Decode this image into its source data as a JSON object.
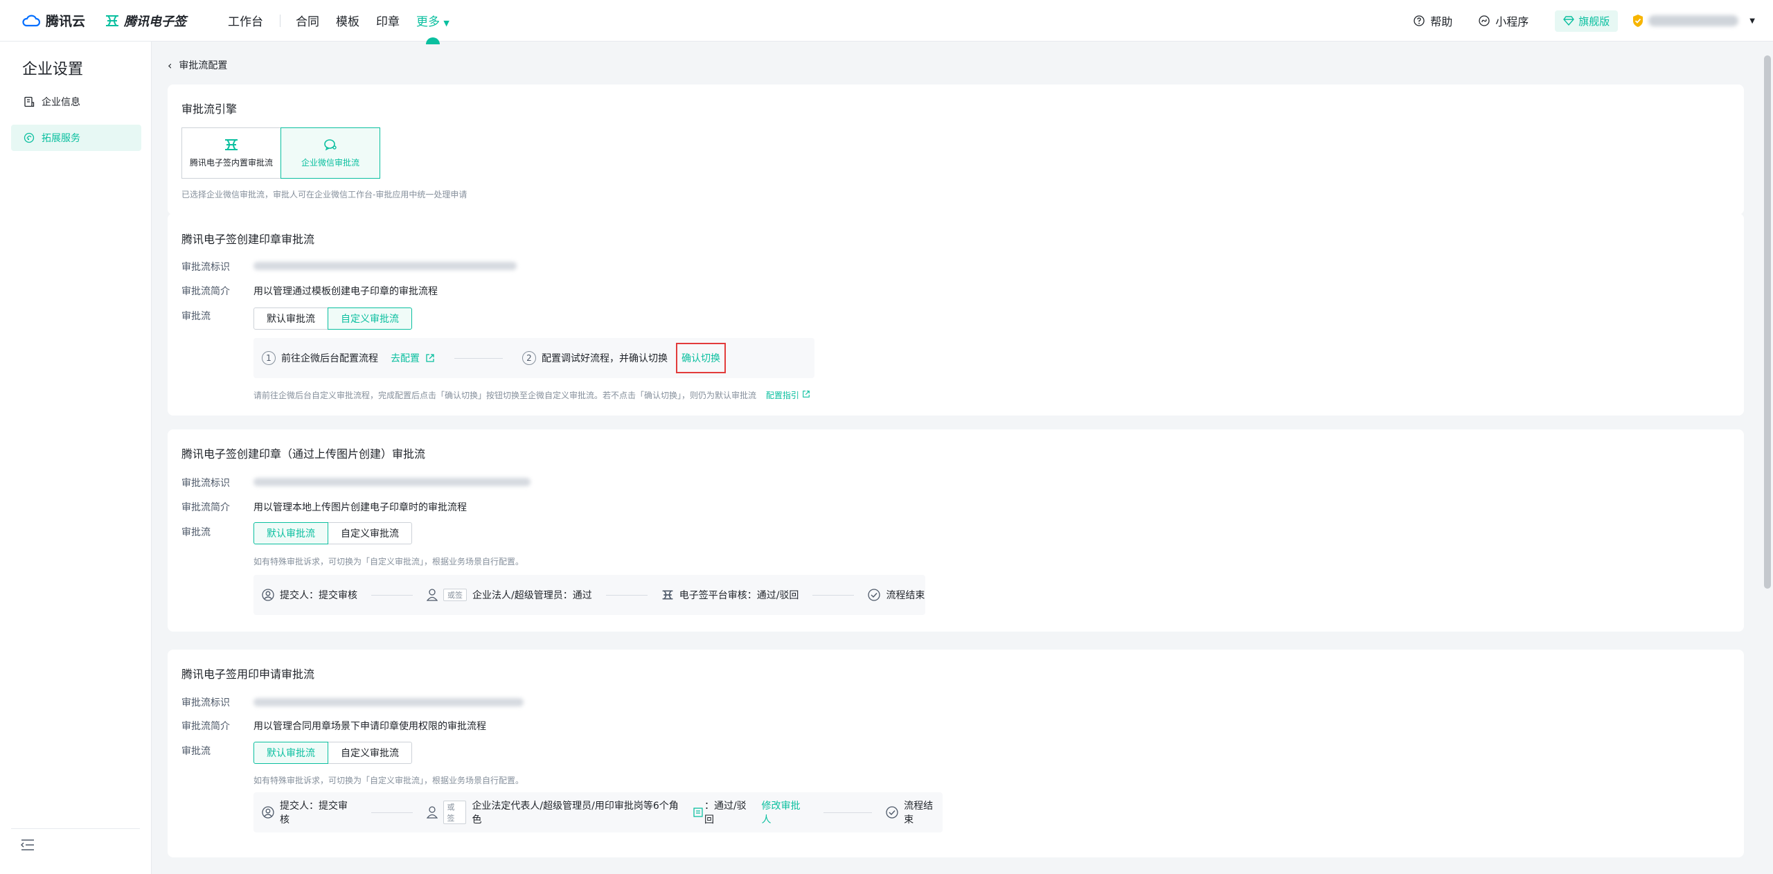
{
  "header": {
    "brand1": "腾讯云",
    "brand2": "腾讯电子签",
    "nav": [
      "工作台",
      "合同",
      "模板",
      "印章",
      "更多"
    ],
    "help": "帮助",
    "miniprogram": "小程序",
    "edition": "旗舰版"
  },
  "sidebar": {
    "title": "企业设置",
    "items": [
      {
        "label": "企业信息"
      },
      {
        "label": "拓展服务"
      }
    ]
  },
  "breadcrumb": "审批流配置",
  "engine": {
    "title": "审批流引擎",
    "options": [
      "腾讯电子签内置审批流",
      "企业微信审批流"
    ],
    "selected": "企业微信审批流",
    "hint": "已选择企业微信审批流，审批人可在企业微信工作台-审批应用中统一处理申请"
  },
  "labels": {
    "id": "审批流标识",
    "desc": "审批流简介",
    "flow": "审批流",
    "default_flow": "默认审批流",
    "custom_flow": "自定义审批流",
    "or": "或签"
  },
  "card1": {
    "title": "腾讯电子签创建印章审批流",
    "desc": "用以管理通过模板创建电子印章的审批流程",
    "step1": "前往企微后台配置流程",
    "step1_link": "去配置",
    "step2": "配置调试好流程，并确认切换",
    "step2_link": "确认切换",
    "hint": "请前往企微后台自定义审批流程，完成配置后点击「确认切换」按钮切换至企微自定义审批流。若不点击「确认切换」，则仍为默认审批流",
    "hint_link": "配置指引"
  },
  "card2": {
    "title": "腾讯电子签创建印章（通过上传图片创建）审批流",
    "desc": "用以管理本地上传图片创建电子印章时的审批流程",
    "hint": "如有特殊审批诉求，可切换为「自定义审批流」，根据业务场景自行配置。",
    "submit": "提交人：提交审核",
    "approver": "企业法人/超级管理员：通过",
    "platform": "电子签平台审核：通过/驳回",
    "end": "流程结束"
  },
  "card3": {
    "title": "腾讯电子签用印申请审批流",
    "desc": "用以管理合同用章场景下申请印章使用权限的审批流程",
    "hint": "如有特殊审批诉求，可切换为「自定义审批流」，根据业务场景自行配置。",
    "submit": "提交人：提交审核",
    "approver": "企业法定代表人/超级管理员/用印审批岗等6个角色",
    "approver_result": "：通过/驳回",
    "modify": "修改审批人",
    "end": "流程结束"
  },
  "colors": {
    "accent": "#0abf9f",
    "highlight_border": "#e23b3b"
  }
}
